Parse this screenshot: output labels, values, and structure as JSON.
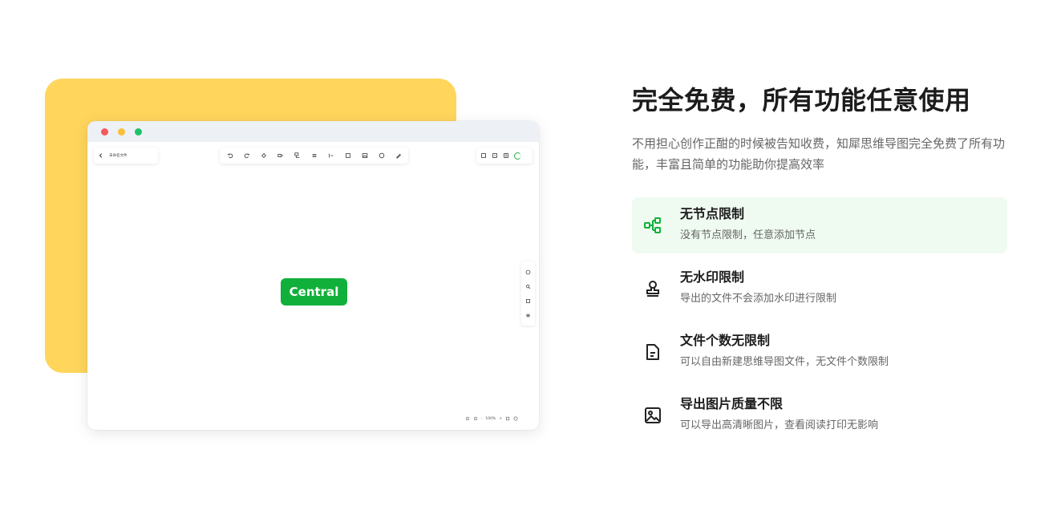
{
  "colors": {
    "accent_yellow": "#FFD55C",
    "brand_green": "#11B03A",
    "active_bg": "#EFFAF1",
    "text_dark": "#1C1C1C",
    "text_muted": "#666666"
  },
  "mockup": {
    "central_node_label": "Central",
    "breadcrumb_text": "未命名文件",
    "toolbar_icons": [
      "undo-icon",
      "redo-icon",
      "paint-icon",
      "node-icon",
      "subnode-icon",
      "summary-icon",
      "relation-icon",
      "frame-icon",
      "image-icon",
      "emoji-icon",
      "pen-icon"
    ],
    "right_toolbar_icons": [
      "save-icon",
      "export-icon",
      "share-icon",
      "progress-icon"
    ],
    "side_tools_icons": [
      "theme-icon",
      "search-icon",
      "outline-icon",
      "menu-icon"
    ],
    "zoom_level": "100%"
  },
  "content": {
    "heading": "完全免费，所有功能任意使用",
    "subtitle": "不用担心创作正酣的时候被告知收费，知犀思维导图完全免费了所有功能，丰富且简单的功能助你提高效率",
    "features": [
      {
        "title": "无节点限制",
        "desc": "没有节点限制，任意添加节点",
        "icon": "node-tree-icon",
        "active": true
      },
      {
        "title": "无水印限制",
        "desc": "导出的文件不会添加水印进行限制",
        "icon": "stamp-icon",
        "active": false
      },
      {
        "title": "文件个数无限制",
        "desc": "可以自由新建思维导图文件，无文件个数限制",
        "icon": "document-icon",
        "active": false
      },
      {
        "title": "导出图片质量不限",
        "desc": "可以导出高清晰图片，查看阅读打印无影响",
        "icon": "image-icon",
        "active": false
      }
    ]
  }
}
